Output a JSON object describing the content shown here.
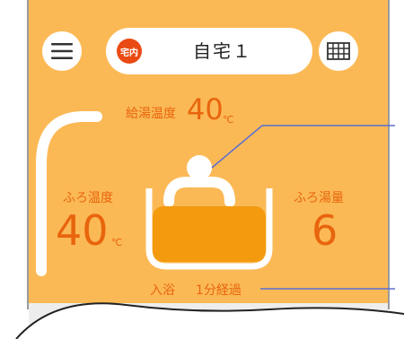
{
  "header": {
    "menu_icon": "hamburger-menu-icon",
    "home_badge": "宅内",
    "home_name": "自宅１",
    "grid_icon": "grid-icon"
  },
  "supply": {
    "label": "給湯温度",
    "value": "40",
    "unit": "℃"
  },
  "bath_temp": {
    "label": "ふろ温度",
    "value": "40",
    "unit": "℃"
  },
  "bath_level": {
    "label": "ふろ湯量",
    "value": "6"
  },
  "status": {
    "bath_state": "入浴",
    "elapsed": "1分経過"
  },
  "colors": {
    "panel_bg": "#fbb956",
    "accent_text": "#e8650d",
    "badge": "#ea4a13",
    "water": "#f39a0e",
    "annotation": "#5a6fd0"
  }
}
